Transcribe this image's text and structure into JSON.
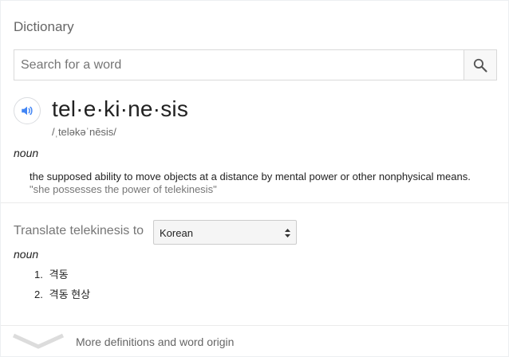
{
  "header": {
    "title": "Dictionary"
  },
  "search": {
    "placeholder": "Search for a word",
    "value": ""
  },
  "entry": {
    "word": "tel·e·ki·ne·sis",
    "phonetic": "/ˌteləkəˈnēsis/",
    "pos": "noun",
    "definition": "the supposed ability to move objects at a distance by mental power or other nonphysical means.",
    "example": "\"she possesses the power of telekinesis\""
  },
  "translate": {
    "label": "Translate telekinesis to",
    "selected_language": "Korean",
    "pos": "noun",
    "items": [
      {
        "num": "1.",
        "text": "격동"
      },
      {
        "num": "2.",
        "text": "격동 현상"
      }
    ]
  },
  "footer": {
    "more_label": "More definitions and word origin"
  },
  "colors": {
    "accent": "#4285f4",
    "icon_gray": "#555555"
  },
  "icons": {
    "search": "search-icon",
    "speaker": "speaker-icon",
    "expand": "chevron-down-icon",
    "select": "updown-arrows-icon"
  }
}
